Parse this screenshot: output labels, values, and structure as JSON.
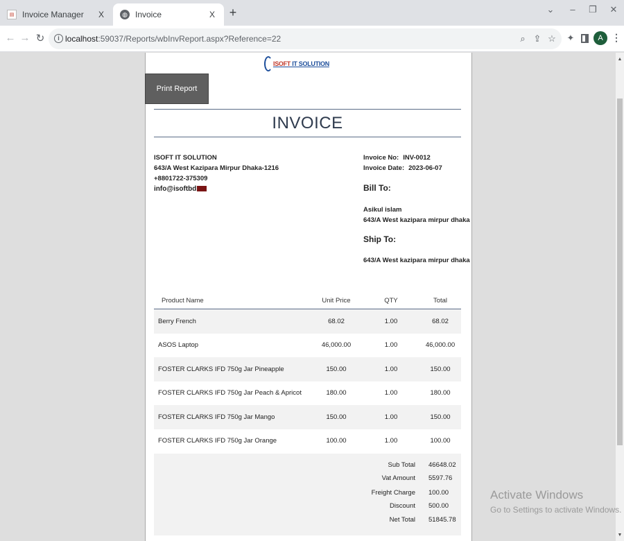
{
  "browser": {
    "tabs": [
      {
        "title": "Invoice Manager",
        "close": "X"
      },
      {
        "title": "Invoice",
        "close": "X"
      }
    ],
    "new_tab": "+",
    "url_host": "localhost",
    "url_rest": ":59037/Reports/wbInvReport.aspx?Reference=22"
  },
  "logo": {
    "prefix": "ISOFT",
    "suffix": " IT SOLUTION"
  },
  "print_button": "Print Report",
  "invoice": {
    "title": "INVOICE",
    "company": {
      "name": "ISOFT IT SOLUTION",
      "address": "643/A West Kazipara Mirpur Dhaka-1216",
      "phone": "+8801722-375309",
      "email": "info@isoftbd"
    },
    "meta": {
      "no_label": "Invoice No:",
      "no_value": "INV-0012",
      "date_label": "Invoice Date:",
      "date_value": "2023-06-07"
    },
    "bill_to": {
      "heading": "Bill To:",
      "name": "Asikul islam",
      "address": "643/A West kazipara mirpur dhaka"
    },
    "ship_to": {
      "heading": "Ship To:",
      "address": "643/A West kazipara mirpur dhaka"
    },
    "columns": {
      "name": "Product Name",
      "price": "Unit Price",
      "qty": "QTY",
      "total": "Total"
    },
    "items": [
      {
        "name": "Berry French",
        "price": "68.02",
        "qty": "1.00",
        "total": "68.02"
      },
      {
        "name": "ASOS Laptop",
        "price": "46,000.00",
        "qty": "1.00",
        "total": "46,000.00"
      },
      {
        "name": "FOSTER CLARKS IFD 750g Jar Pineapple",
        "price": "150.00",
        "qty": "1.00",
        "total": "150.00"
      },
      {
        "name": "FOSTER CLARKS IFD 750g Jar Peach & Apricot",
        "price": "180.00",
        "qty": "1.00",
        "total": "180.00"
      },
      {
        "name": "FOSTER CLARKS IFD 750g Jar Mango",
        "price": "150.00",
        "qty": "1.00",
        "total": "150.00"
      },
      {
        "name": "FOSTER CLARKS IFD 750g Jar Orange",
        "price": "100.00",
        "qty": "1.00",
        "total": "100.00"
      }
    ],
    "totals": [
      {
        "label": "Sub Total",
        "value": "46648.02"
      },
      {
        "label": "Vat Amount",
        "value": "5597.76"
      },
      {
        "label": "Freight Charge",
        "value": "100.00"
      },
      {
        "label": "Discount",
        "value": "500.00"
      },
      {
        "label": "Net Total",
        "value": "51845.78"
      }
    ]
  },
  "watermark": {
    "line1": "Activate Windows",
    "line2": "Go to Settings to activate Windows."
  },
  "colors": {
    "accent_rule": "#5a6b86",
    "button_bg": "#5f5f5f",
    "row_shade": "#f2f2f2"
  }
}
